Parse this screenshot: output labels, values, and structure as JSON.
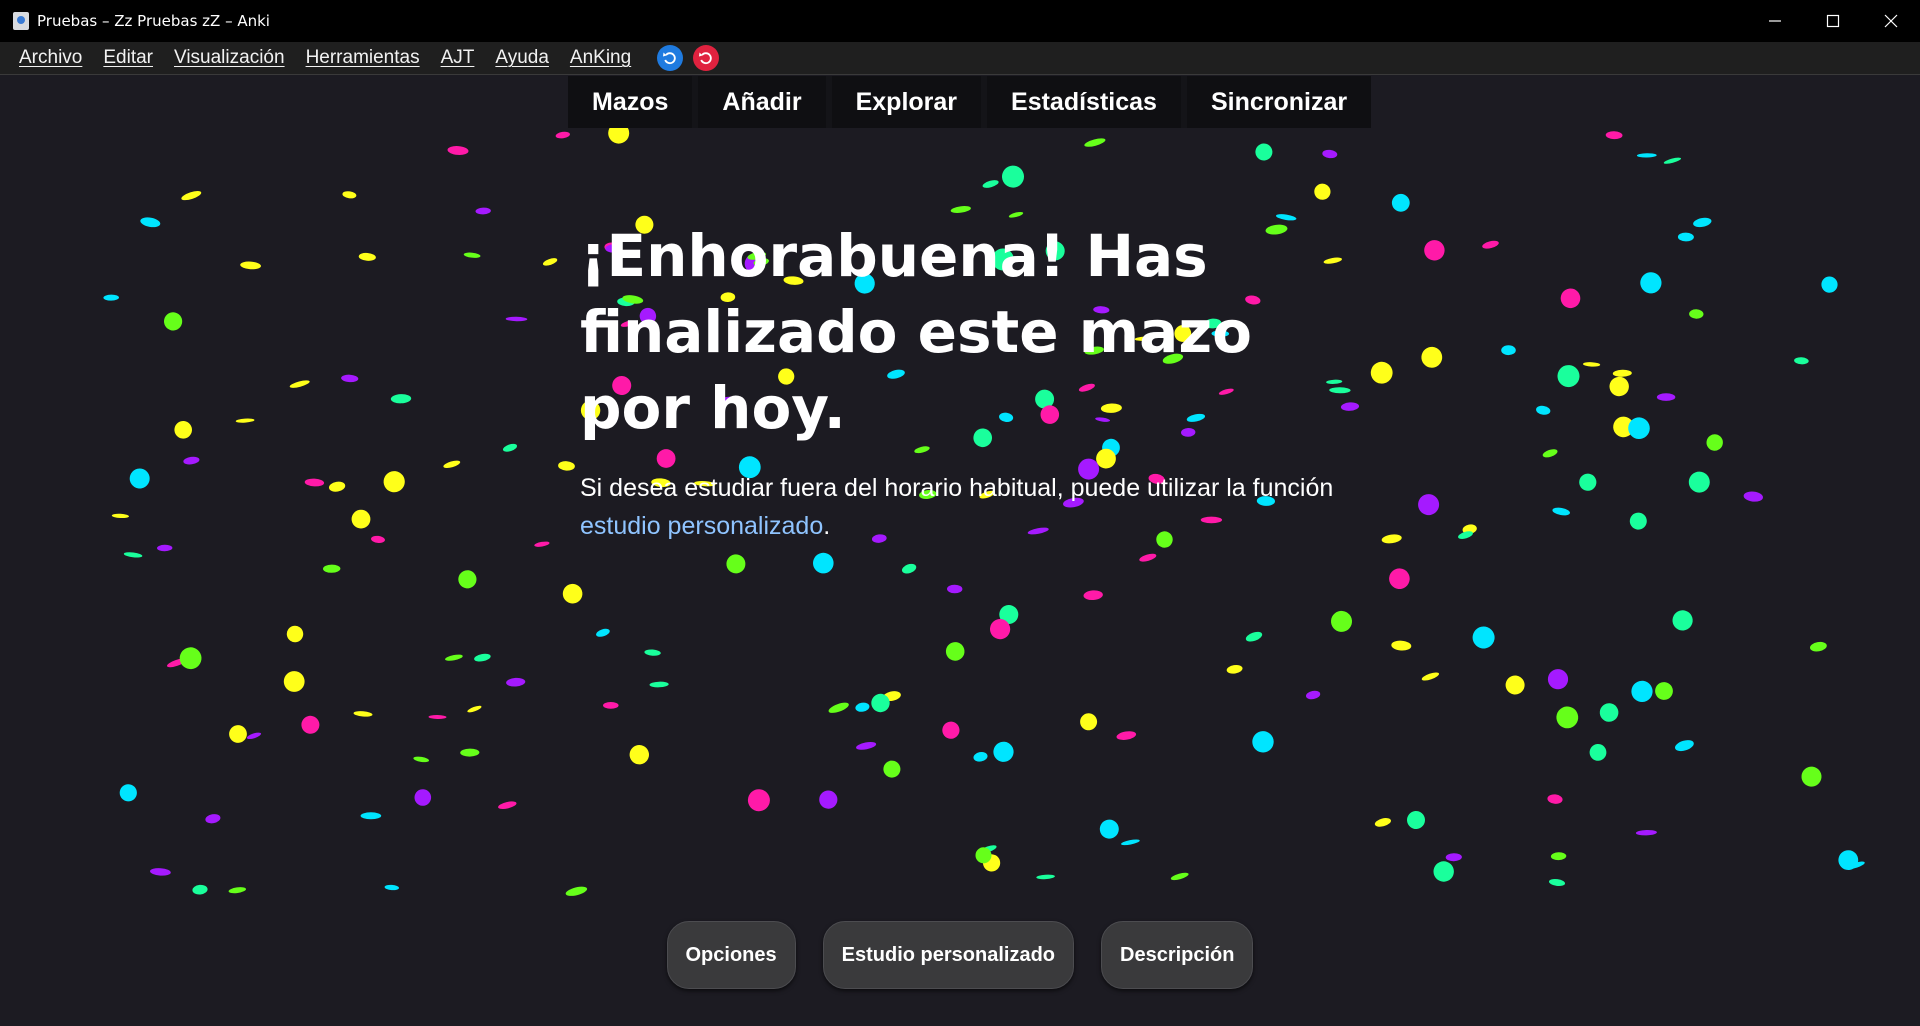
{
  "window": {
    "title": "Pruebas – Zz Pruebas zZ – Anki"
  },
  "menu": {
    "items": [
      {
        "label": "Archivo"
      },
      {
        "label": "Editar"
      },
      {
        "label": "Visualización"
      },
      {
        "label": "Herramientas"
      },
      {
        "label": "AJT"
      },
      {
        "label": "Ayuda"
      },
      {
        "label": "AnKing"
      }
    ]
  },
  "toolbar": {
    "items": [
      {
        "label": "Mazos"
      },
      {
        "label": "Añadir"
      },
      {
        "label": "Explorar"
      },
      {
        "label": "Estadísticas"
      },
      {
        "label": "Sincronizar"
      }
    ]
  },
  "main": {
    "heading": "¡Enhorabuena! Has finalizado este mazo por hoy.",
    "message_before_link": "Si desea estudiar fuera del horario habitual, puede utilizar la función ",
    "message_link": "estudio personalizado",
    "message_after_link": "."
  },
  "bottom": {
    "options_label": "Opciones",
    "custom_study_label": "Estudio personalizado",
    "description_label": "Descripción"
  },
  "colors": {
    "background": "#1c1b22",
    "link": "#8fc4ff",
    "confetti": [
      "#ff1aa8",
      "#00e5ff",
      "#ffff1a",
      "#66ff1a",
      "#1aff9c",
      "#a51aff"
    ]
  }
}
